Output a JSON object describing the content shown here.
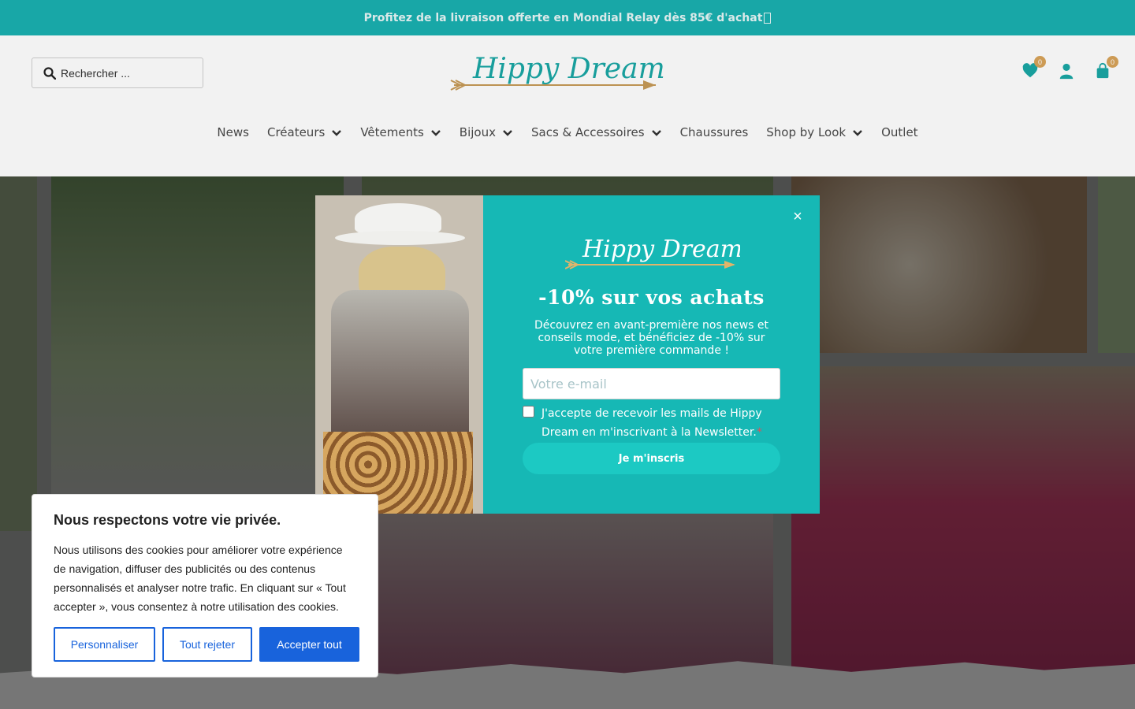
{
  "promo": {
    "text": "Profitez de la livraison offerte en Mondial Relay dès 85€ d'achat ",
    "icon": "truck-icon"
  },
  "header": {
    "search_placeholder": "Rechercher ...",
    "logo_text": "Hippy Dream",
    "wishlist_count": "0",
    "cart_count": "0"
  },
  "nav": {
    "items": [
      {
        "label": "News",
        "has_dropdown": false
      },
      {
        "label": "Créateurs",
        "has_dropdown": true
      },
      {
        "label": "Vêtements",
        "has_dropdown": true
      },
      {
        "label": "Bijoux",
        "has_dropdown": true
      },
      {
        "label": "Sacs & Accessoires",
        "has_dropdown": true
      },
      {
        "label": "Chaussures",
        "has_dropdown": false
      },
      {
        "label": "Shop by Look",
        "has_dropdown": true
      },
      {
        "label": "Outlet",
        "has_dropdown": false
      }
    ]
  },
  "popup": {
    "logo_text": "Hippy Dream",
    "title": "-10% sur vos achats",
    "text": "Découvrez en avant-première nos news et conseils mode, et bénéficiez de -10% sur votre première commande !",
    "email_placeholder": "Votre e-mail",
    "consent_label": "J'accepte de recevoir les mails de Hippy Dream en m'inscrivant à la Newsletter.",
    "required_mark": "*",
    "submit_label": "Je m'inscris",
    "close_label": "×"
  },
  "cookie": {
    "title": "Nous respectons votre vie privée.",
    "text": "Nous utilisons des cookies pour améliorer votre expérience de navigation, diffuser des publicités ou des contenus personnalisés et analyser notre trafic. En cliquant sur « Tout accepter », vous consentez à notre utilisation des cookies.",
    "customize_label": "Personnaliser",
    "reject_label": "Tout rejeter",
    "accept_label": "Accepter tout"
  },
  "colors": {
    "brand_teal": "#16b8b5",
    "brand_gold": "#d9a45a",
    "cookie_blue": "#1863dc"
  }
}
